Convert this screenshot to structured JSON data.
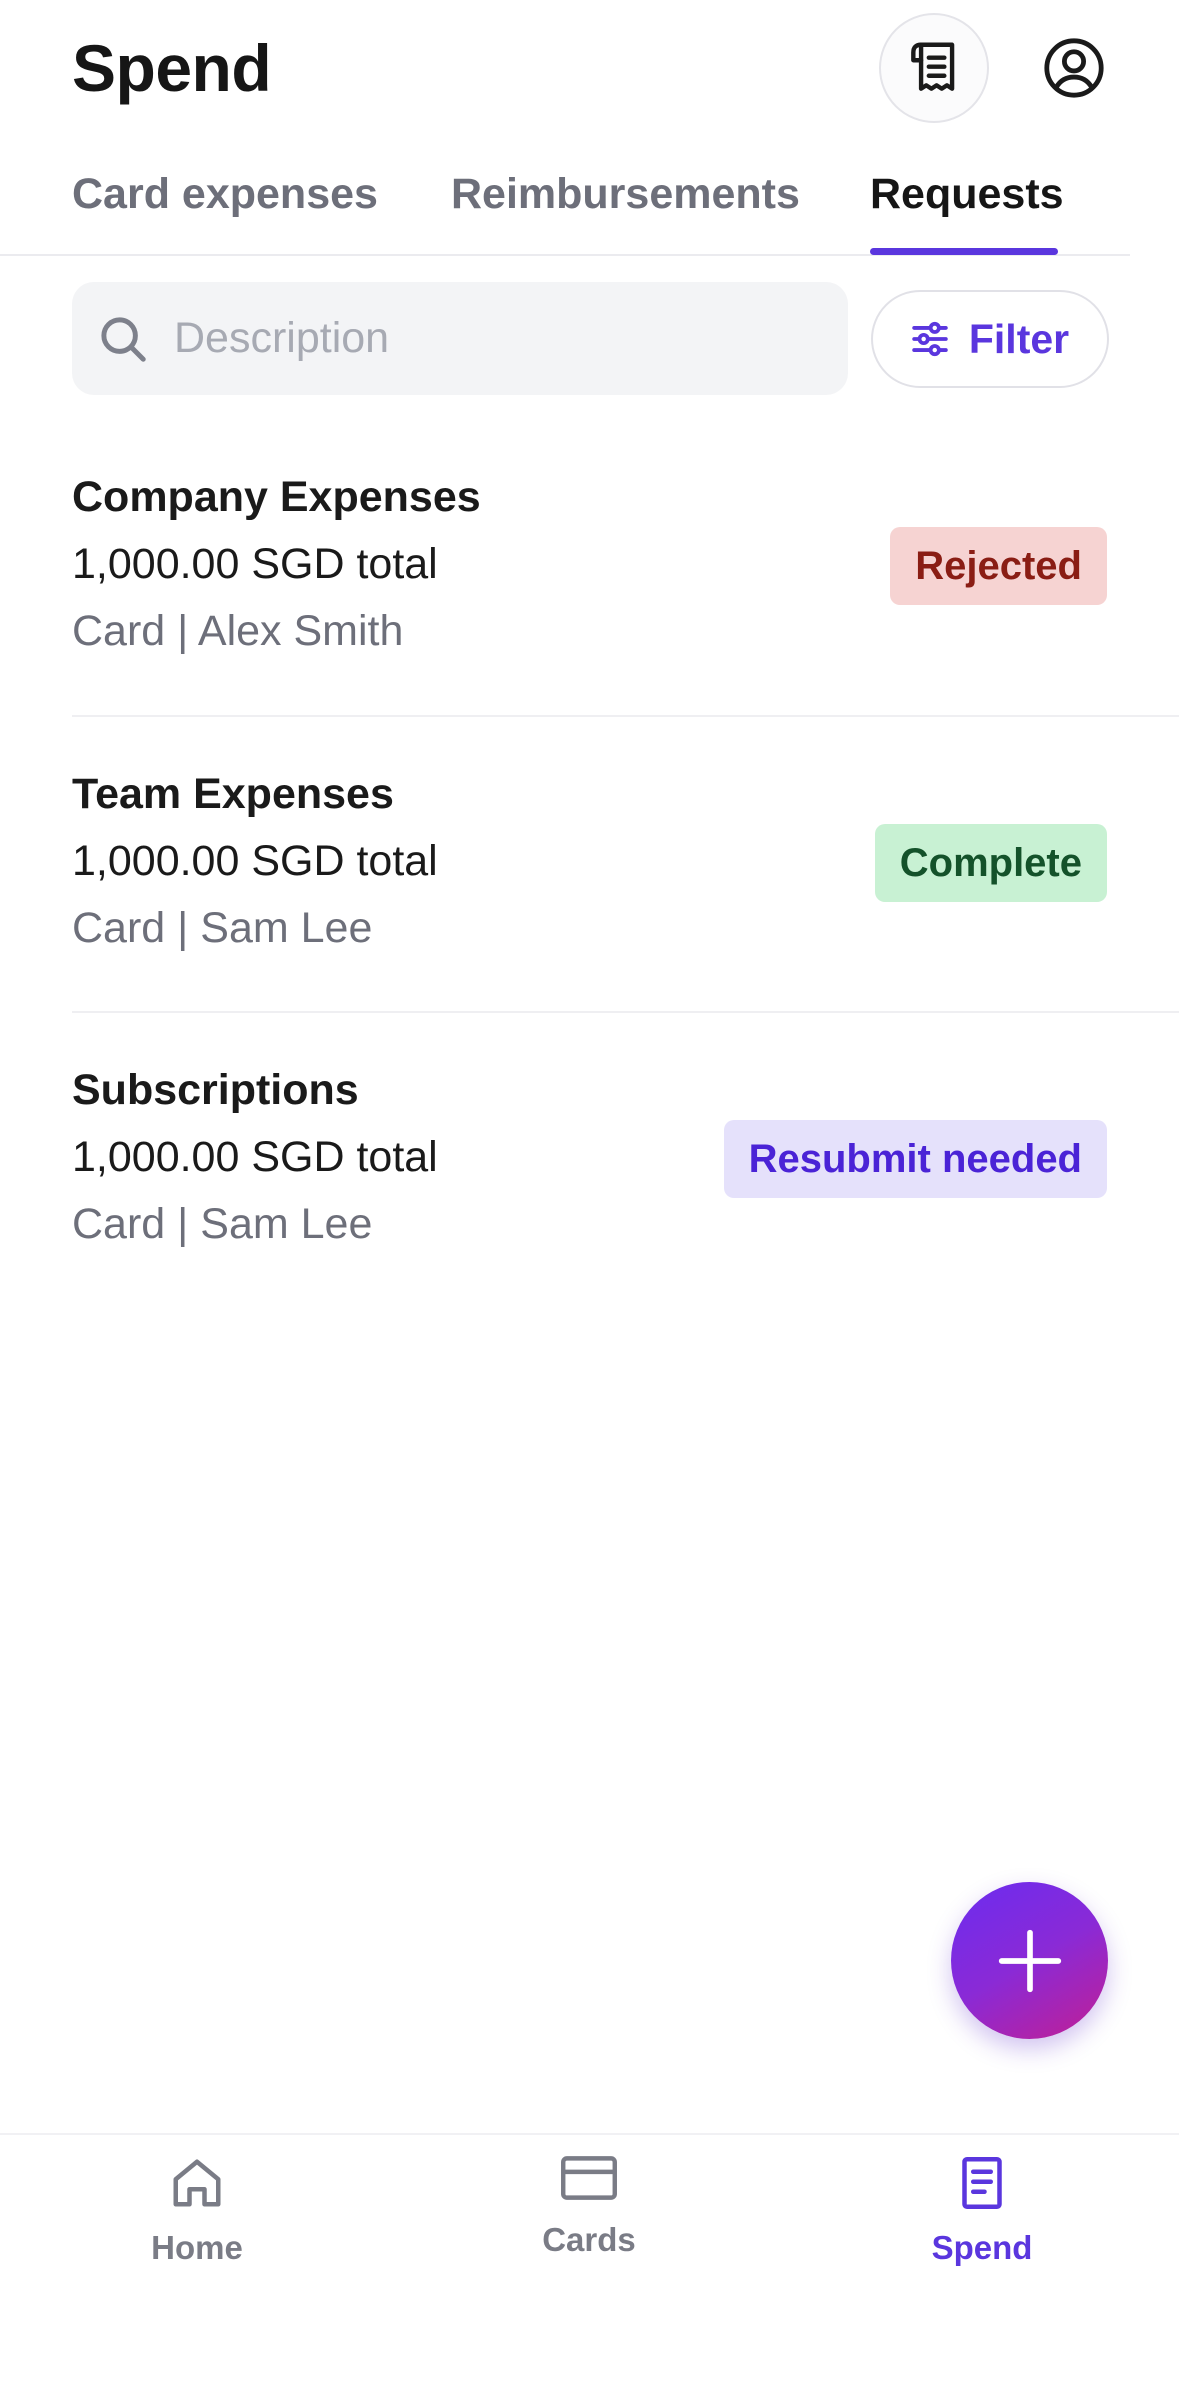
{
  "header": {
    "title": "Spend",
    "receipt_icon": "receipt-icon",
    "profile_icon": "user-circle-icon"
  },
  "tabs": [
    {
      "label": "Card expenses",
      "active": false
    },
    {
      "label": "Reimbursements",
      "active": false
    },
    {
      "label": "Requests",
      "active": true
    }
  ],
  "search": {
    "placeholder": "Description",
    "value": "",
    "icon": "search-icon"
  },
  "filter": {
    "label": "Filter",
    "icon": "sliders-icon"
  },
  "requests": [
    {
      "title": "Company Expenses",
      "amount": "1,000.00 SGD total",
      "meta": "Card | Alex Smith",
      "status": "Rejected"
    },
    {
      "title": "Team Expenses",
      "amount": "1,000.00 SGD total",
      "meta": "Card | Sam Lee",
      "status": "Complete"
    },
    {
      "title": "Subscriptions",
      "amount": "1,000.00 SGD total",
      "meta": "Card | Sam Lee",
      "status": "Resubmit needed"
    }
  ],
  "fab": {
    "icon": "plus-icon"
  },
  "bottom_nav": [
    {
      "label": "Home",
      "icon": "home-icon",
      "active": false
    },
    {
      "label": "Cards",
      "icon": "card-icon",
      "active": false
    },
    {
      "label": "Spend",
      "icon": "document-icon",
      "active": true
    }
  ],
  "colors": {
    "accent": "#5a36de",
    "rejected_bg": "#f6d3d2",
    "rejected_text": "#8a1d14",
    "complete_bg": "#c8f1d3",
    "complete_text": "#14522a",
    "resubmit_bg": "#e5e1fb",
    "resubmit_text": "#4a23d6"
  }
}
